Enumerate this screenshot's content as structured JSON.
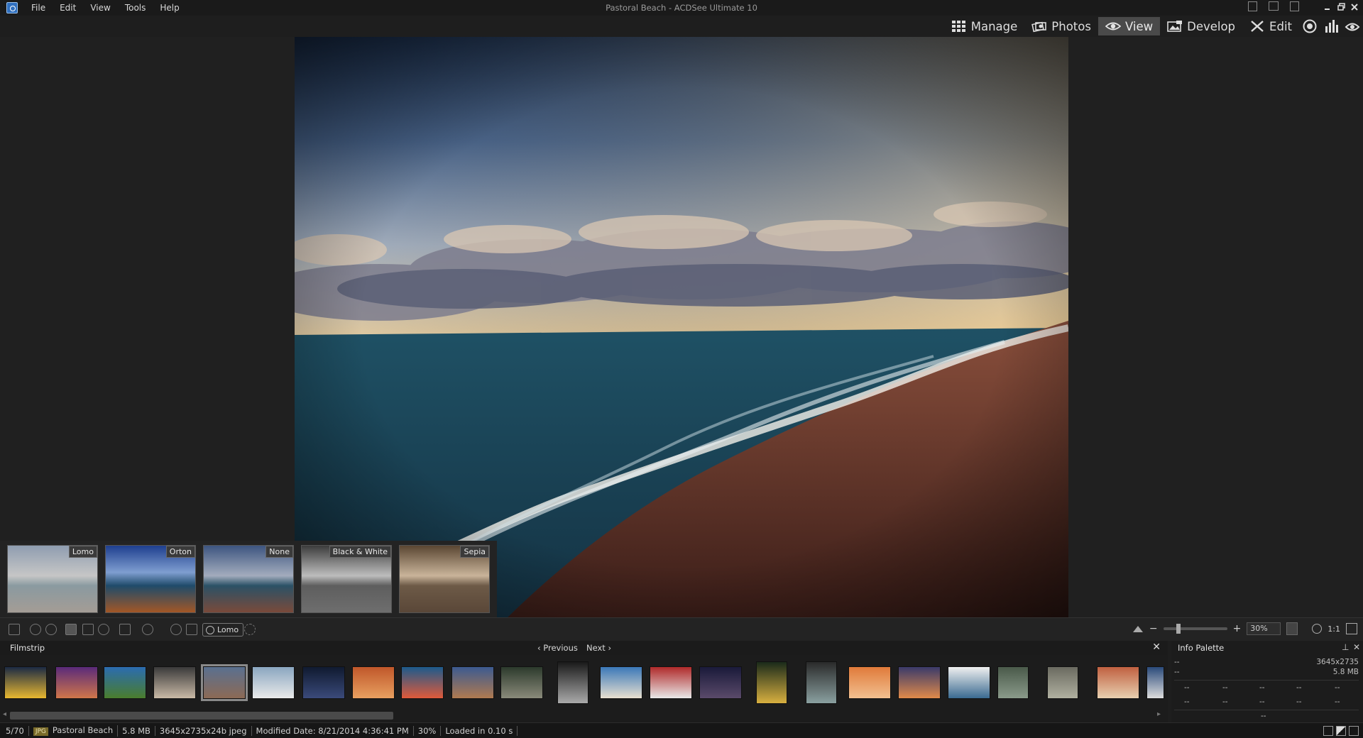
{
  "window": {
    "title": "Pastoral Beach - ACDSee Ultimate 10"
  },
  "menu": [
    "File",
    "Edit",
    "View",
    "Tools",
    "Help"
  ],
  "modes": [
    {
      "label": "Manage",
      "icon": "grid-icon",
      "active": false
    },
    {
      "label": "Photos",
      "icon": "photos-icon",
      "active": false
    },
    {
      "label": "View",
      "icon": "eye-icon",
      "active": true
    },
    {
      "label": "Develop",
      "icon": "develop-icon",
      "active": false
    },
    {
      "label": "Edit",
      "icon": "edit-icon",
      "active": false
    }
  ],
  "presets": [
    "Lomo",
    "Orton",
    "None",
    "Black & White",
    "Sepia"
  ],
  "toolbar": {
    "preset_chip": "Lomo",
    "zoom": "30%",
    "ratio": "1:1"
  },
  "filmstrip": {
    "title": "Filmstrip",
    "prev": "Previous",
    "next": "Next",
    "selected_index": 4,
    "thumb_count": 24
  },
  "info_palette": {
    "title": "Info Palette",
    "left_top": "--",
    "left_second": "--",
    "dims": "3645x2735",
    "size": "5.8 MB",
    "grid": [
      "--",
      "--",
      "--",
      "--",
      "--",
      "--",
      "--",
      "--",
      "--",
      "--"
    ],
    "bottom": "--"
  },
  "status": {
    "position": "5/70",
    "format": "JPG",
    "name": "Pastoral Beach",
    "filesize": "5.8 MB",
    "details": "3645x2735x24b jpeg",
    "modified": "Modified Date: 8/21/2014 4:36:41 PM",
    "zoom": "30%",
    "load_time": "Loaded in 0.10 s"
  },
  "colors": {
    "active_tab": "#4a4a4a",
    "accent_blue": "#2f6fbf",
    "jpg_badge": "#7a6b2a"
  }
}
